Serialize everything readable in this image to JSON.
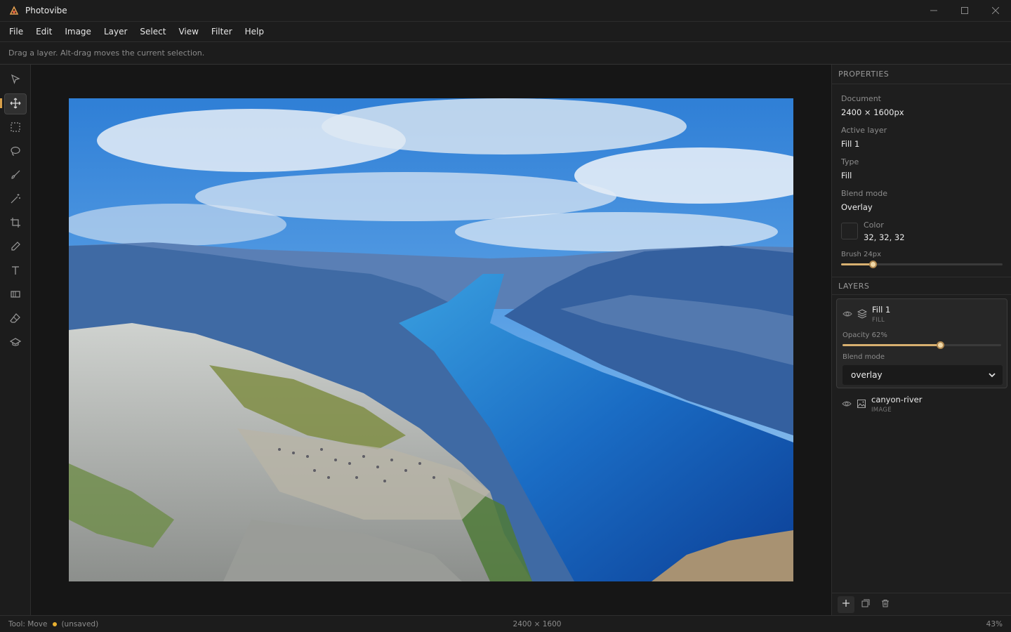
{
  "app": {
    "title": "Photovibe"
  },
  "window": {
    "minimize_icon": "minimize-icon",
    "maximize_icon": "maximize-icon",
    "close_icon": "close-icon"
  },
  "menu": {
    "items": [
      "File",
      "Edit",
      "Image",
      "Layer",
      "Select",
      "View",
      "Filter",
      "Help"
    ]
  },
  "hint": {
    "text": "Drag a layer. Alt-drag moves the current selection."
  },
  "toolbar": {
    "tools": [
      "pointer-icon",
      "move-icon",
      "marquee-icon",
      "lasso-icon",
      "brush-icon",
      "magic-wand-icon",
      "crop-icon",
      "eyedropper-icon",
      "text-icon",
      "gradient-icon",
      "eraser-icon",
      "smudge-icon"
    ],
    "active": "move-icon"
  },
  "properties": {
    "header": "PROPERTIES",
    "document_label": "Document",
    "document_value": "2400 × 1600px",
    "active_layer_label": "Active layer",
    "active_layer_value": "Fill 1",
    "type_label": "Type",
    "type_value": "Fill",
    "blend_label": "Blend mode",
    "blend_value": "Overlay",
    "color_label": "Color",
    "color_value": "32, 32, 32",
    "color_hex": "#202020",
    "brush_label": "Brush 24px",
    "brush_level": 0.2
  },
  "layers": {
    "header": "LAYERS",
    "items": [
      {
        "name": "Fill 1",
        "type": "FILL",
        "opacity_label": "Opacity 62%",
        "opacity": 0.62,
        "blend_label": "Blend mode",
        "blend_value": "overlay"
      },
      {
        "name": "canyon-river",
        "type": "IMAGE"
      }
    ]
  },
  "status": {
    "tool": "Tool: Move",
    "saved_state": "(unsaved)",
    "dimensions": "2400 × 1600",
    "zoom": "43%"
  },
  "colors": {
    "accent": "#d8b070",
    "unsaved_dot": "#e8b030"
  }
}
